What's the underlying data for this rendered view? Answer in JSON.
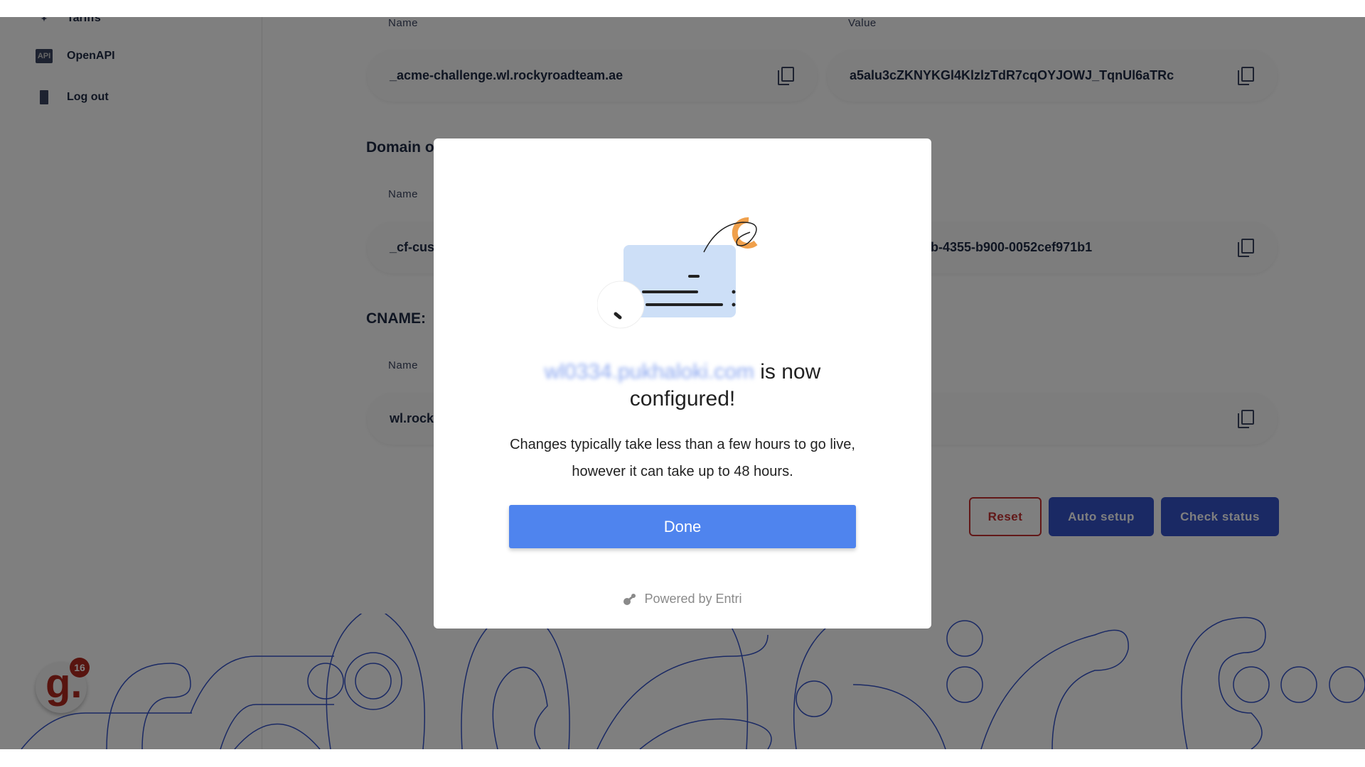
{
  "sidebar": {
    "items": [
      {
        "label": "Tariffs",
        "icon": "tariffs-icon"
      },
      {
        "label": "OpenAPI",
        "icon": "api-icon",
        "icon_text": "API"
      },
      {
        "label": "Log out",
        "icon": "door-icon"
      }
    ]
  },
  "records": {
    "name_label": "Name",
    "value_label": "Value",
    "txt": {
      "name": "_acme-challenge.wl.rockyroadteam.ae",
      "value": "a5alu3cZKNYKGl4KlzlzTdR7cqOYJOWJ_TqnUl6aTRc"
    },
    "domain_heading": "Domain o",
    "domain": {
      "name": "_cf-cus",
      "value": "b-4355-b900-0052cef971b1"
    },
    "cname_heading": "CNAME:",
    "cname": {
      "name": "wl.rock",
      "value": ""
    }
  },
  "actions": {
    "reset": "Reset",
    "auto_setup": "Auto setup",
    "check_status": "Check status"
  },
  "logo": {
    "letter": "g.",
    "badge": "16"
  },
  "modal": {
    "domain_blurred": "wl0334.pukhaloki.com",
    "headline_suffix": "is now",
    "headline_line2": "configured!",
    "body": "Changes typically take less than a few hours to go live, however it can take up to 48 hours.",
    "done": "Done",
    "powered_by": "Powered by Entri"
  },
  "colors": {
    "primary": "#4f84ee",
    "navy": "#3452c9",
    "danger": "#c53030",
    "accent": "#f0a04b"
  }
}
